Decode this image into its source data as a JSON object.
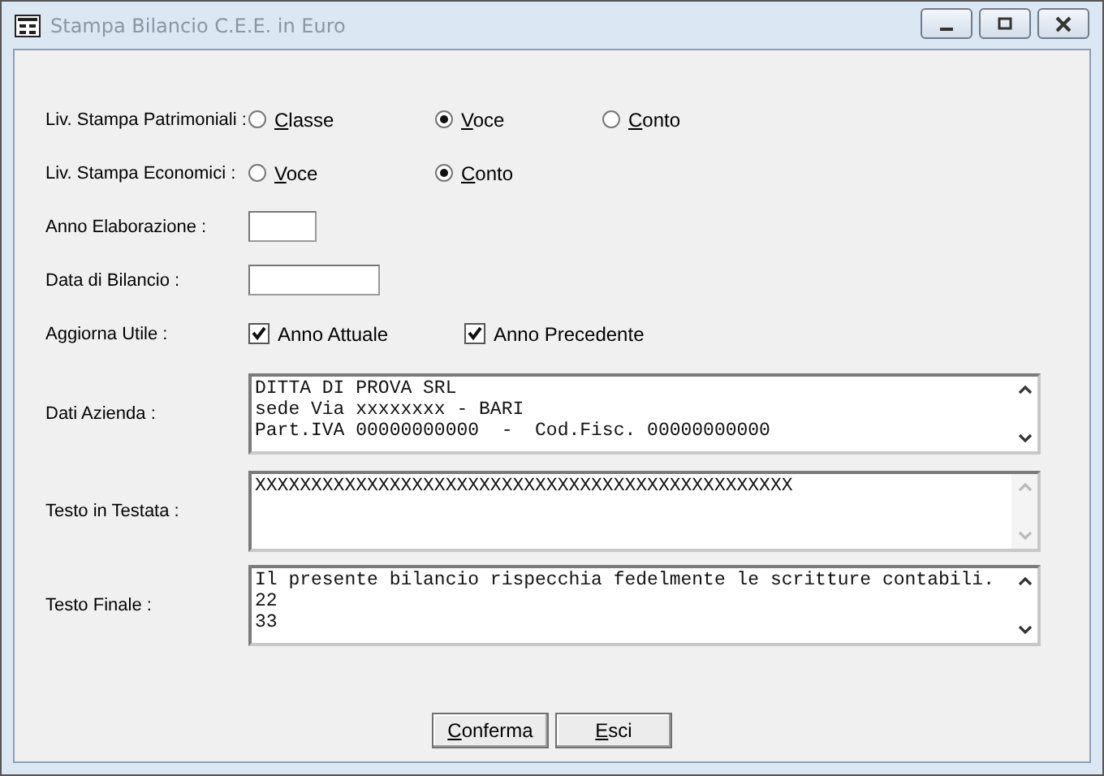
{
  "window": {
    "title": "Stampa Bilancio C.E.E. in Euro"
  },
  "radio_rows": [
    {
      "label": "Liv. Stampa Patrimoniali :",
      "options": [
        {
          "label": "Classe",
          "selected": false
        },
        {
          "label": "Voce",
          "selected": true
        },
        {
          "label": "Conto",
          "selected": false
        }
      ]
    },
    {
      "label": "Liv. Stampa Economici :",
      "options": [
        {
          "label": "Voce",
          "selected": false
        },
        {
          "label": "Conto",
          "selected": true
        }
      ]
    }
  ],
  "fields": [
    {
      "label": "Anno Elaborazione :"
    },
    {
      "label": "Data di Bilancio :"
    }
  ],
  "checkbox_row": {
    "label": "Aggiorna Utile :",
    "options": [
      {
        "label": "Anno Attuale",
        "checked": true
      },
      {
        "label": "Anno Precedente",
        "checked": true
      }
    ]
  },
  "text_areas": [
    {
      "label": "Dati Azienda :",
      "lines": [
        "DITTA DI PROVA SRL",
        "sede Via xxxxxxxx - BARI",
        "Part.IVA 00000000000  -  Cod.Fisc. 00000000000"
      ],
      "scrollbar_enabled": true
    },
    {
      "label": "Testo in Testata :",
      "lines": [
        "XXXXXXXXXXXXXXXXXXXXXXXXXXXXXXXXXXXXXXXXXXXXXXXX"
      ],
      "scrollbar_enabled": false
    },
    {
      "label": "Testo Finale :",
      "lines": [
        "Il presente bilancio rispecchia fedelmente le scritture contabili.",
        "22",
        "33"
      ],
      "scrollbar_enabled": true
    }
  ],
  "buttons": [
    "Conferma",
    "Esci"
  ]
}
